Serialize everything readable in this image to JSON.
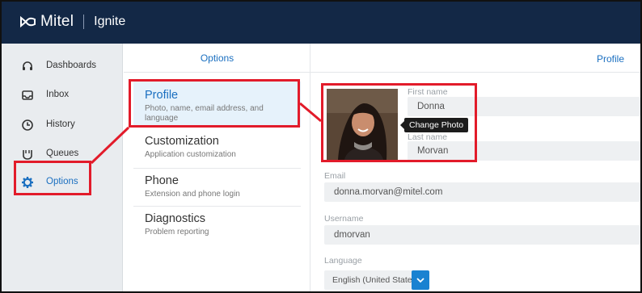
{
  "app": {
    "brand": "Mitel",
    "product": "Ignite"
  },
  "sidebar": {
    "items": [
      {
        "label": "Dashboards",
        "icon": "headset-icon"
      },
      {
        "label": "Inbox",
        "icon": "inbox-icon"
      },
      {
        "label": "History",
        "icon": "clock-icon"
      },
      {
        "label": "Queues",
        "icon": "queue-icon"
      },
      {
        "label": "Options",
        "icon": "gear-icon",
        "active": true
      }
    ]
  },
  "options": {
    "header": "Options",
    "items": [
      {
        "title": "Profile",
        "desc": "Photo, name, email address, and language",
        "selected": true
      },
      {
        "title": "Customization",
        "desc": "Application customization"
      },
      {
        "title": "Phone",
        "desc": "Extension and phone login"
      },
      {
        "title": "Diagnostics",
        "desc": "Problem reporting"
      }
    ]
  },
  "profile": {
    "header": "Profile",
    "tooltip": "Change Photo",
    "first_name_label": "First name",
    "first_name": "Donna",
    "last_name_label": "Last name",
    "last_name": "Morvan",
    "email_label": "Email",
    "email": "donna.morvan@mitel.com",
    "username_label": "Username",
    "username": "dmorvan",
    "language_label": "Language",
    "language": "English (United States)"
  },
  "colors": {
    "topbar": "#132846",
    "accent": "#1a6fc0",
    "highlight": "#e21b2a",
    "select_button": "#1a82d1"
  }
}
